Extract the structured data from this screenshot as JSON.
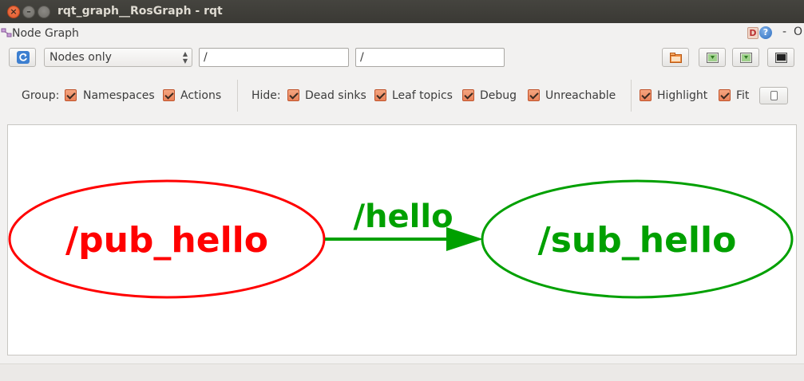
{
  "window": {
    "title": "rqt_graph__RosGraph - rqt"
  },
  "plugin": {
    "title": "Node Graph",
    "help_d": "D",
    "help_q": "?",
    "minimize": "-",
    "close": "O"
  },
  "toolbar": {
    "mode_value": "Nodes only",
    "node_filter": "/",
    "topic_filter": "/"
  },
  "options": {
    "group_label": "Group:",
    "namespaces": "Namespaces",
    "actions": "Actions",
    "hide_label": "Hide:",
    "dead_sinks": "Dead sinks",
    "leaf_topics": "Leaf topics",
    "debug": "Debug",
    "unreachable": "Unreachable",
    "highlight": "Highlight",
    "fit": "Fit"
  },
  "graph": {
    "nodes": [
      {
        "label": "/pub_hello",
        "color": "#ff0000"
      },
      {
        "label": "/sub_hello",
        "color": "#00a000"
      }
    ],
    "edge": {
      "label": "/hello",
      "color": "#00a000"
    }
  },
  "icons": {
    "refresh": "refresh-icon",
    "load": "open-folder-icon",
    "save_dot": "save-dot-icon",
    "save_svg": "save-svg-icon",
    "save_image": "save-image-icon",
    "screenshot": "screenshot-icon"
  }
}
